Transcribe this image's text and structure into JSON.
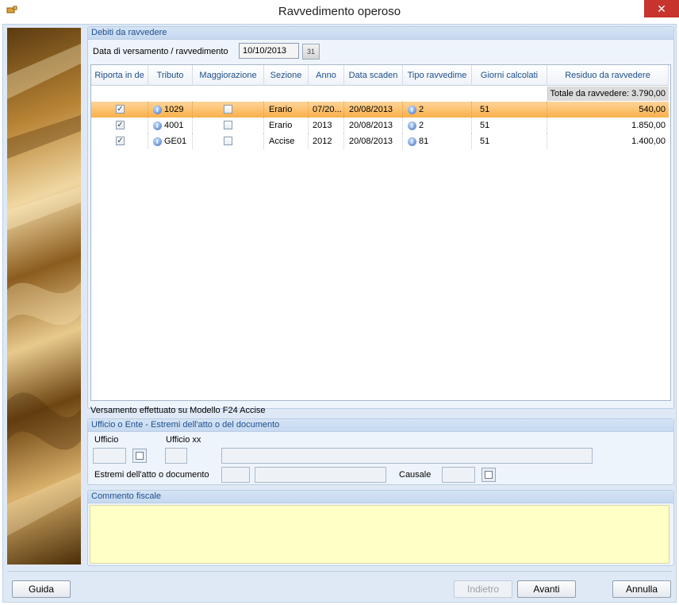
{
  "window": {
    "title": "Ravvedimento operoso",
    "close_label": "✕"
  },
  "debiti": {
    "group_title": "Debiti da ravvedere",
    "date_label": "Data di versamento / ravvedimento",
    "date_value": "10/10/2013",
    "calendar_label": "31",
    "columns": [
      "Riporta in de",
      "Tributo",
      "Maggiorazione",
      "Sezione",
      "Anno",
      "Data scaden",
      "Tipo ravvedime",
      "Giorni calcolati",
      "Residuo da ravvedere"
    ],
    "total_label": "Totale da ravvedere: 3.790,00",
    "rows": [
      {
        "riporta": true,
        "tributo": "1029",
        "maggiorazione": false,
        "sezione": "Erario",
        "anno": "07/20...",
        "data_scadenza": "20/08/2013",
        "tipo": "2",
        "giorni": "51",
        "residuo": "540,00",
        "selected": true
      },
      {
        "riporta": true,
        "tributo": "4001",
        "maggiorazione": false,
        "sezione": "Erario",
        "anno": "2013",
        "data_scadenza": "20/08/2013",
        "tipo": "2",
        "giorni": "51",
        "residuo": "1.850,00",
        "selected": false
      },
      {
        "riporta": true,
        "tributo": "GE01",
        "maggiorazione": false,
        "sezione": "Accise",
        "anno": "2012",
        "data_scadenza": "20/08/2013",
        "tipo": "81",
        "giorni": "51",
        "residuo": "1.400,00",
        "selected": false
      }
    ]
  },
  "versamento_note": "Versamento effettuato su Modello F24 Accise",
  "ufficio": {
    "group_title": "Ufficio o Ente - Estremi dell'atto o del documento",
    "ufficio_label": "Ufficio",
    "ufficio_xx_label": "Ufficio xx",
    "estremi_label": "Estremi dell'atto o documento",
    "causale_label": "Causale"
  },
  "commento": {
    "group_title": "Commento fiscale",
    "value": ""
  },
  "buttons": {
    "guida": "Guida",
    "indietro": "Indietro",
    "avanti": "Avanti",
    "annulla": "Annulla"
  },
  "colors": {
    "selected_row": "#f9b04a",
    "group_title": "#1e4f8c",
    "comment_bg": "#ffffc6",
    "close_button": "#c7332d"
  }
}
